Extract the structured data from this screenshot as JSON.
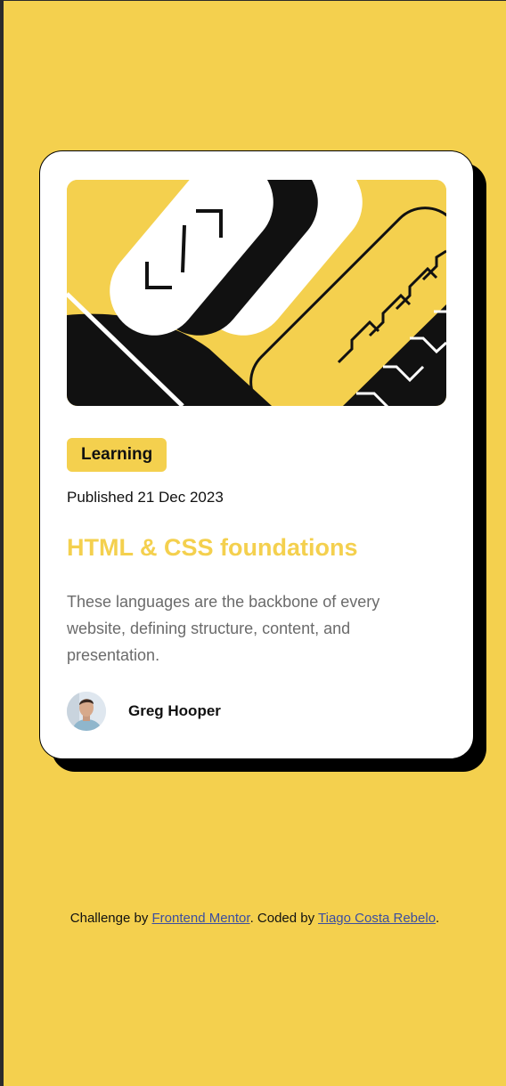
{
  "card": {
    "tag": "Learning",
    "published": "Published 21 Dec 2023",
    "title": "HTML & CSS foundations",
    "description": "These languages are the backbone of every website, defining structure, content, and presentation.",
    "author": "Greg Hooper"
  },
  "footer": {
    "prefix": "Challenge by ",
    "link1": "Frontend Mentor",
    "middle": ". Coded by ",
    "link2": "Tiago Costa Rebelo",
    "suffix": "."
  },
  "colors": {
    "background": "#f4d04e",
    "card": "#ffffff",
    "shadow": "#000000",
    "title": "#f4d04e",
    "description": "#6b6b6b",
    "link": "#3b4ea0"
  }
}
